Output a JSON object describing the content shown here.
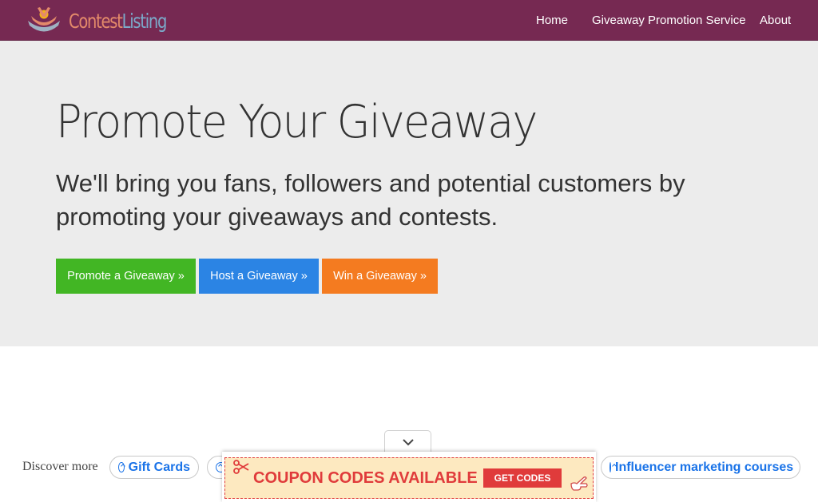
{
  "navbar": {
    "brand_part1": "Contest",
    "brand_part2": "Listing",
    "links": [
      "Home",
      "Giveaway Promotion Service",
      "About"
    ]
  },
  "hero": {
    "title": "Promote Your Giveaway",
    "subtitle": "We'll bring you fans, followers and potential customers by promoting your giveaways and contests.",
    "buttons": [
      "Promote a Giveaway »",
      "Host a Giveaway »",
      "Win a Giveaway »"
    ]
  },
  "discover": {
    "label": "Discover more",
    "chips": [
      "Gift Cards",
      "Influencer marketing courses"
    ]
  },
  "ad": {
    "headline": "COUPON CODES AVAILABLE",
    "button": "GET CODES"
  },
  "colors": {
    "navbar": "#762952",
    "hero_bg": "#ececec",
    "btn_green": "#42b624",
    "btn_blue": "#2b84e4",
    "btn_orange": "#f47b20",
    "link_blue": "#1a73e8",
    "coupon_red": "#e03b3b",
    "coupon_bg": "#fde9c0"
  }
}
